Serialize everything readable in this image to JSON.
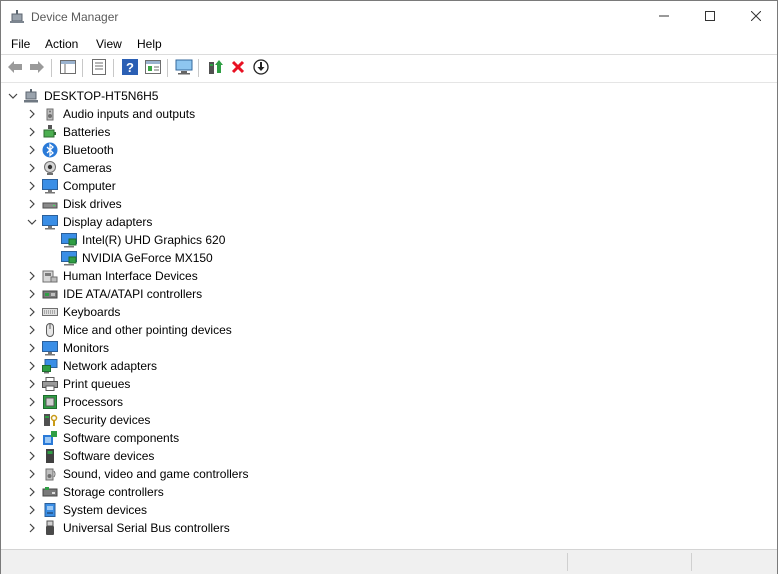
{
  "window": {
    "title": "Device Manager",
    "controls": {
      "minimize": "minimize-icon",
      "maximize": "maximize-icon",
      "close": "close-icon"
    }
  },
  "menu": [
    "File",
    "Action",
    "View",
    "Help"
  ],
  "toolbar": [
    "back-arrow-icon",
    "forward-arrow-icon",
    "show-hide-tree-icon",
    "properties-icon",
    "help-icon",
    "action-pane-icon",
    "scan-hardware-icon",
    "update-driver-icon",
    "uninstall-device-icon",
    "disable-device-icon"
  ],
  "tree": {
    "root": "DESKTOP-HT5N6H5",
    "items": [
      {
        "label": "Audio inputs and outputs",
        "icon": "speaker-icon",
        "expanded": false
      },
      {
        "label": "Batteries",
        "icon": "battery-icon",
        "expanded": false
      },
      {
        "label": "Bluetooth",
        "icon": "bluetooth-icon",
        "expanded": false
      },
      {
        "label": "Cameras",
        "icon": "camera-icon",
        "expanded": false
      },
      {
        "label": "Computer",
        "icon": "computer-icon",
        "expanded": false
      },
      {
        "label": "Disk drives",
        "icon": "disk-drive-icon",
        "expanded": false
      },
      {
        "label": "Display adapters",
        "icon": "display-adapter-icon",
        "expanded": true,
        "children": [
          "Intel(R) UHD Graphics 620",
          "NVIDIA GeForce MX150"
        ]
      },
      {
        "label": "Human Interface Devices",
        "icon": "hid-icon",
        "expanded": false
      },
      {
        "label": "IDE ATA/ATAPI controllers",
        "icon": "ide-controller-icon",
        "expanded": false
      },
      {
        "label": "Keyboards",
        "icon": "keyboard-icon",
        "expanded": false
      },
      {
        "label": "Mice and other pointing devices",
        "icon": "mouse-icon",
        "expanded": false
      },
      {
        "label": "Monitors",
        "icon": "monitor-icon",
        "expanded": false
      },
      {
        "label": "Network adapters",
        "icon": "network-adapter-icon",
        "expanded": false
      },
      {
        "label": "Print queues",
        "icon": "printer-icon",
        "expanded": false
      },
      {
        "label": "Processors",
        "icon": "processor-icon",
        "expanded": false
      },
      {
        "label": "Security devices",
        "icon": "security-device-icon",
        "expanded": false
      },
      {
        "label": "Software components",
        "icon": "software-component-icon",
        "expanded": false
      },
      {
        "label": "Software devices",
        "icon": "software-device-icon",
        "expanded": false
      },
      {
        "label": "Sound, video and game controllers",
        "icon": "sound-controller-icon",
        "expanded": false
      },
      {
        "label": "Storage controllers",
        "icon": "storage-controller-icon",
        "expanded": false
      },
      {
        "label": "System devices",
        "icon": "system-device-icon",
        "expanded": false
      },
      {
        "label": "Universal Serial Bus controllers",
        "icon": "usb-icon",
        "expanded": false
      }
    ]
  },
  "colors": {
    "accent_blue": "#3a8ee6",
    "uninstall_red": "#e81123",
    "gpu_green": "#2f9e44"
  }
}
